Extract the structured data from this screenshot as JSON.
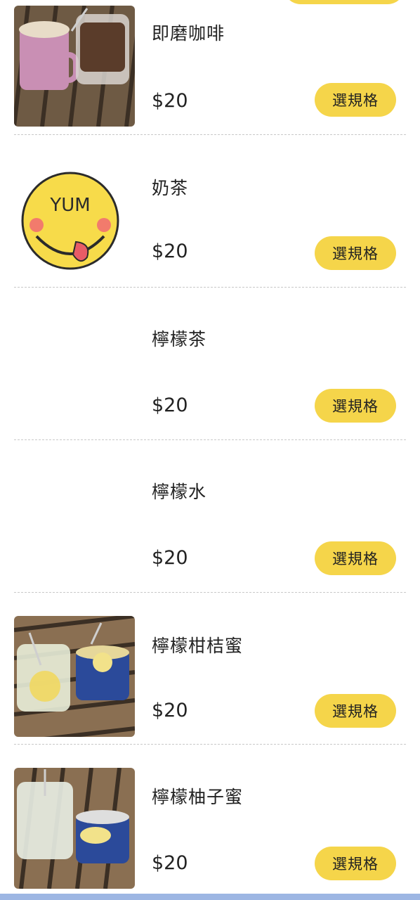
{
  "menu": {
    "items": [
      {
        "name": "即磨咖啡",
        "price": "$20",
        "button_label": "選規格",
        "image": "photo-coffee"
      },
      {
        "name": "奶茶",
        "price": "$20",
        "button_label": "選規格",
        "image": "yum-logo",
        "image_text": "YUM"
      },
      {
        "name": "檸檬茶",
        "price": "$20",
        "button_label": "選規格",
        "image": "none"
      },
      {
        "name": "檸檬水",
        "price": "$20",
        "button_label": "選規格",
        "image": "none"
      },
      {
        "name": "檸檬柑桔蜜",
        "price": "$20",
        "button_label": "選規格",
        "image": "photo-lemon-drinks"
      },
      {
        "name": "檸檬柚子蜜",
        "price": "$20",
        "button_label": "選規格",
        "image": "photo-lemon-drinks-2"
      }
    ]
  },
  "colors": {
    "accent": "#f5d54a",
    "bottom_bar": "#9db6e3",
    "divider": "#c8c8c8"
  }
}
